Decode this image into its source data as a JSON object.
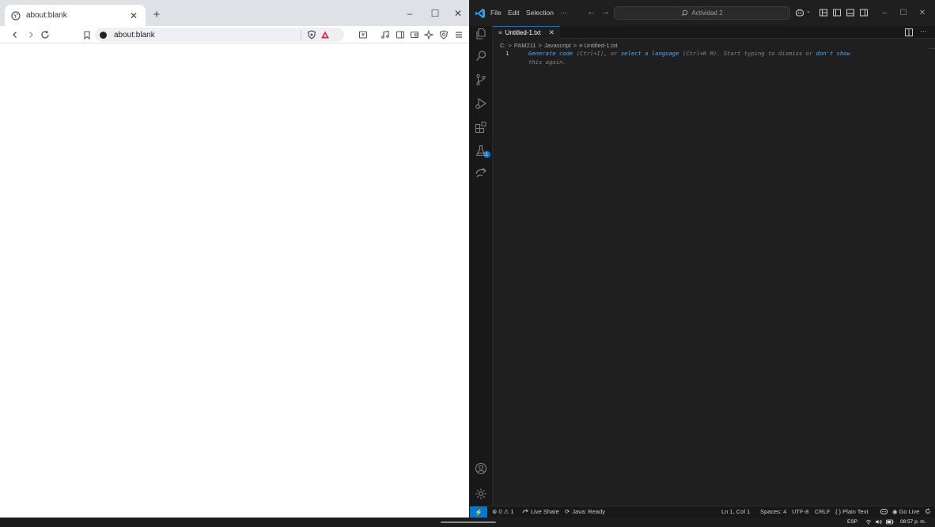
{
  "browser": {
    "tab": {
      "title": "about:blank"
    },
    "url": "about:blank",
    "new_tab": "+",
    "window_controls": {
      "minimize": "–",
      "maximize": "☐",
      "close": "✕"
    }
  },
  "vscode": {
    "menu": {
      "file": "File",
      "edit": "Edit",
      "selection": "Selection",
      "more": "···"
    },
    "search_label": "Actividad 2",
    "tab": {
      "file_icon": "≡",
      "title": "Untitled-1.txt",
      "close": "✕"
    },
    "editor_more": "···",
    "breadcrumbs": [
      "C:",
      ">",
      "PAM211",
      ">",
      "Javascript",
      ">",
      "≡ Untitled-1.txt"
    ],
    "line_number": "1",
    "hint": {
      "link1": "Generate code",
      "text1": " (Ctrl+I), or ",
      "link2": "select a language",
      "text2": " (Ctrl+K M). Start typing to dismiss or ",
      "link3": "don't show",
      "text3": "this again."
    },
    "extensions_badge": "1",
    "status": {
      "problems": "⊗ 0 ⚠ 1",
      "live_share": "Live Share",
      "java": "Java: Ready",
      "position": "Ln 1, Col 1",
      "spaces": "Spaces: 4",
      "encoding": "UTF-8",
      "eol": "CRLF",
      "language": "{ } Plain Text",
      "go_live": "Go Live"
    },
    "accent_color": "#0078d4"
  },
  "taskbar": {
    "language": "ESP",
    "time": "08:57 p. m."
  }
}
